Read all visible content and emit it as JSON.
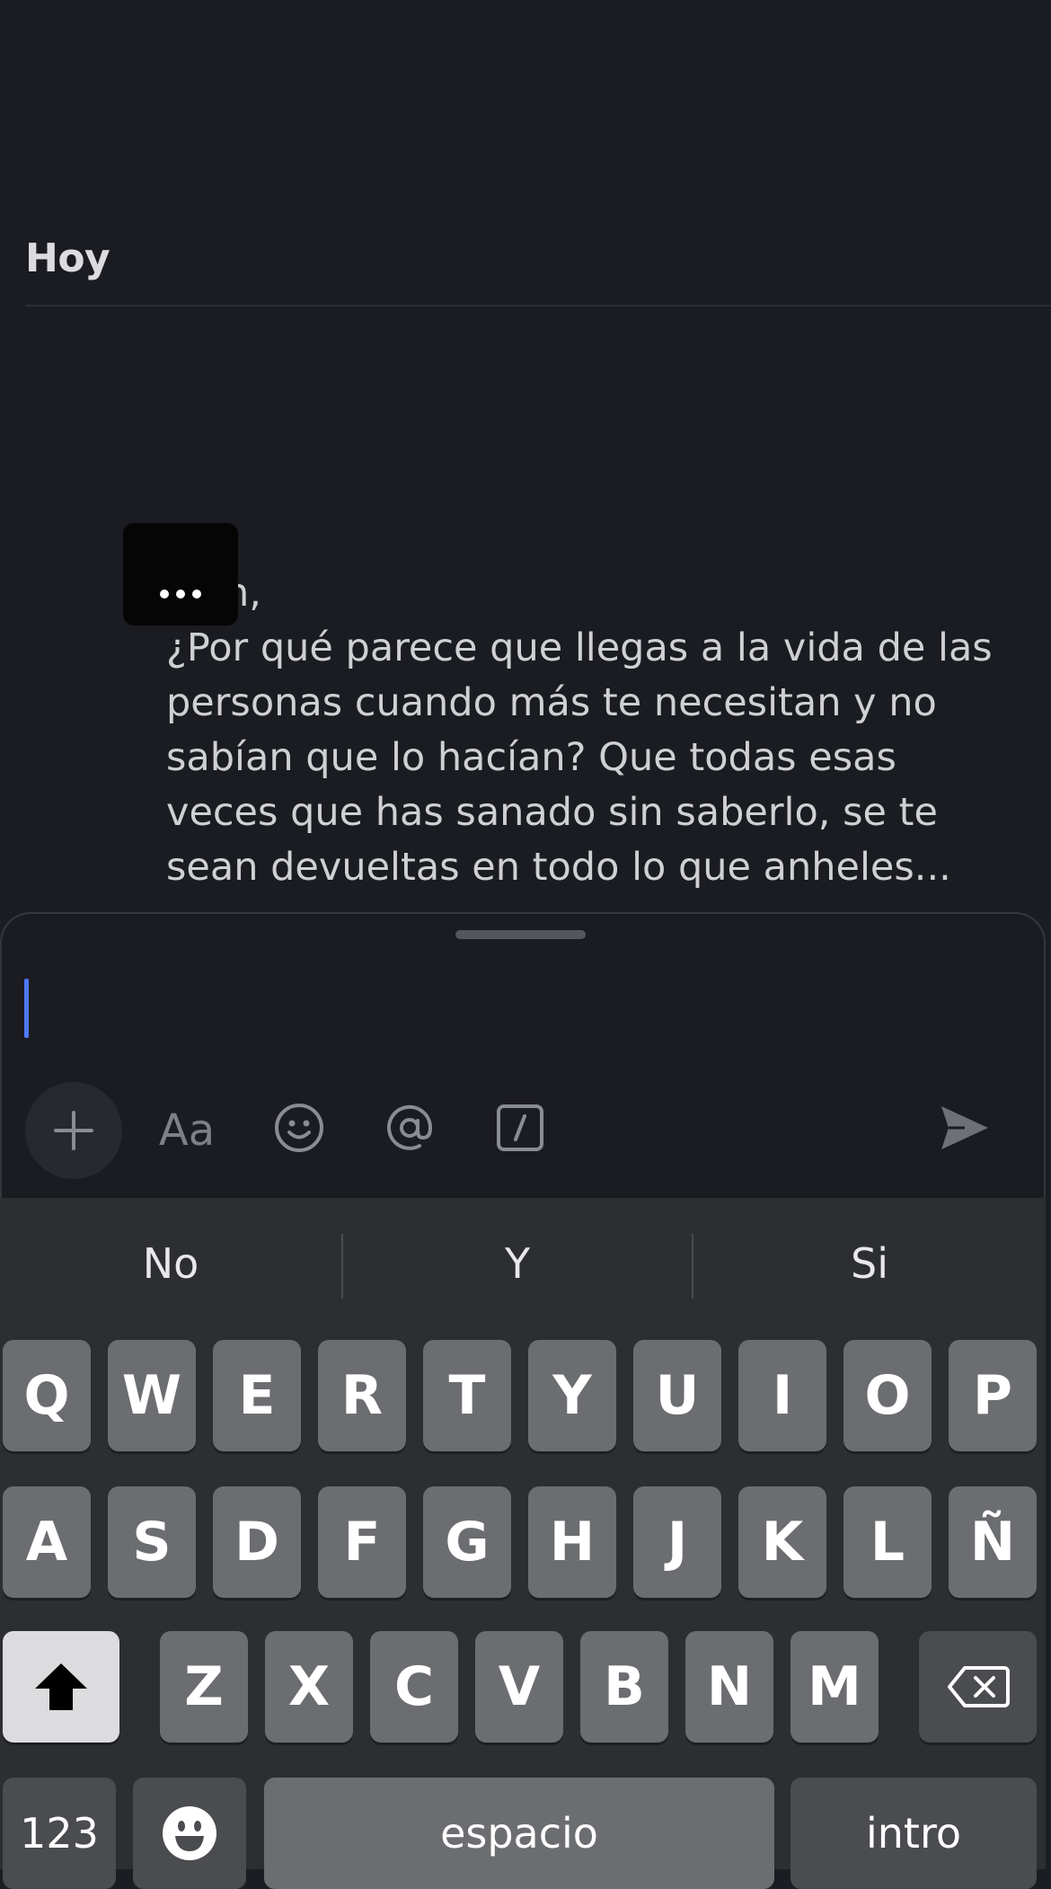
{
  "chat": {
    "day_label": "Hoy",
    "partial_fragment": "n,",
    "message_lines": [
      "¿Por qué parece que llegas a la vida de las",
      "personas cuando más te necesitan y no",
      "sabían que lo hacían? Que todas esas",
      "veces que has sanado sin saberlo, se te",
      "sean devueltas en todo lo que anheles..."
    ],
    "more_button_icon": "more-horizontal-icon"
  },
  "composer": {
    "text_value": "",
    "toolbar": {
      "add_icon": "plus-icon",
      "format_label": "Aa",
      "emoji_icon": "smiley-icon",
      "mention_icon": "at-sign-icon",
      "shortcut_icon": "slash-command-icon",
      "send_icon": "send-arrow-icon"
    }
  },
  "keyboard": {
    "suggestions": [
      "No",
      "Y",
      "Si"
    ],
    "row1": [
      "Q",
      "W",
      "E",
      "R",
      "T",
      "Y",
      "U",
      "I",
      "O",
      "P"
    ],
    "row2": [
      "A",
      "S",
      "D",
      "F",
      "G",
      "H",
      "J",
      "K",
      "L",
      "Ñ"
    ],
    "row3": [
      "Z",
      "X",
      "C",
      "V",
      "B",
      "N",
      "M"
    ],
    "numbers_label": "123",
    "space_label": "espacio",
    "return_label": "intro",
    "shift_icon": "shift-arrow-icon",
    "delete_icon": "backspace-icon",
    "emoji_icon": "emoji-face-icon"
  }
}
